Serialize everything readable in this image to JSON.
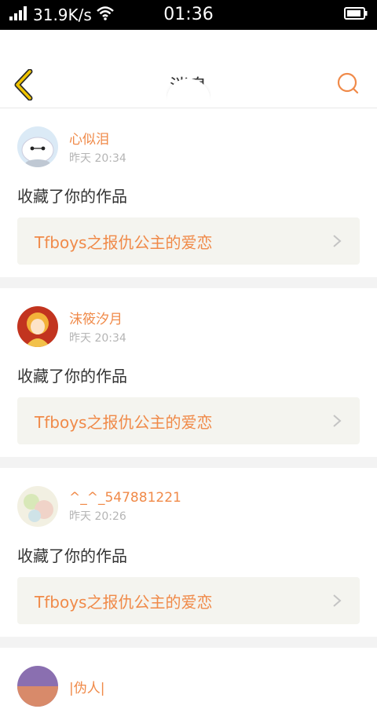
{
  "status_bar": {
    "speed": "31.9K/s",
    "time": "01:36"
  },
  "header": {
    "title": "消息"
  },
  "messages": [
    {
      "username": "心似泪",
      "time": "昨天 20:34",
      "action": "收藏了你的作品",
      "work_title": "Tfboys之报仇公主的爱恋"
    },
    {
      "username": "沫筱汐月",
      "time": "昨天 20:34",
      "action": "收藏了你的作品",
      "work_title": "Tfboys之报仇公主的爱恋"
    },
    {
      "username": "^_^_547881221",
      "time": "昨天 20:26",
      "action": "收藏了你的作品",
      "work_title": "Tfboys之报仇公主的爱恋"
    },
    {
      "username": "|伪人|"
    }
  ],
  "colors": {
    "accent": "#f08a49",
    "back_icon": "#f0c400",
    "text_primary": "#333333",
    "text_muted": "#b5b5b5",
    "work_bg": "#f4f4ef"
  }
}
